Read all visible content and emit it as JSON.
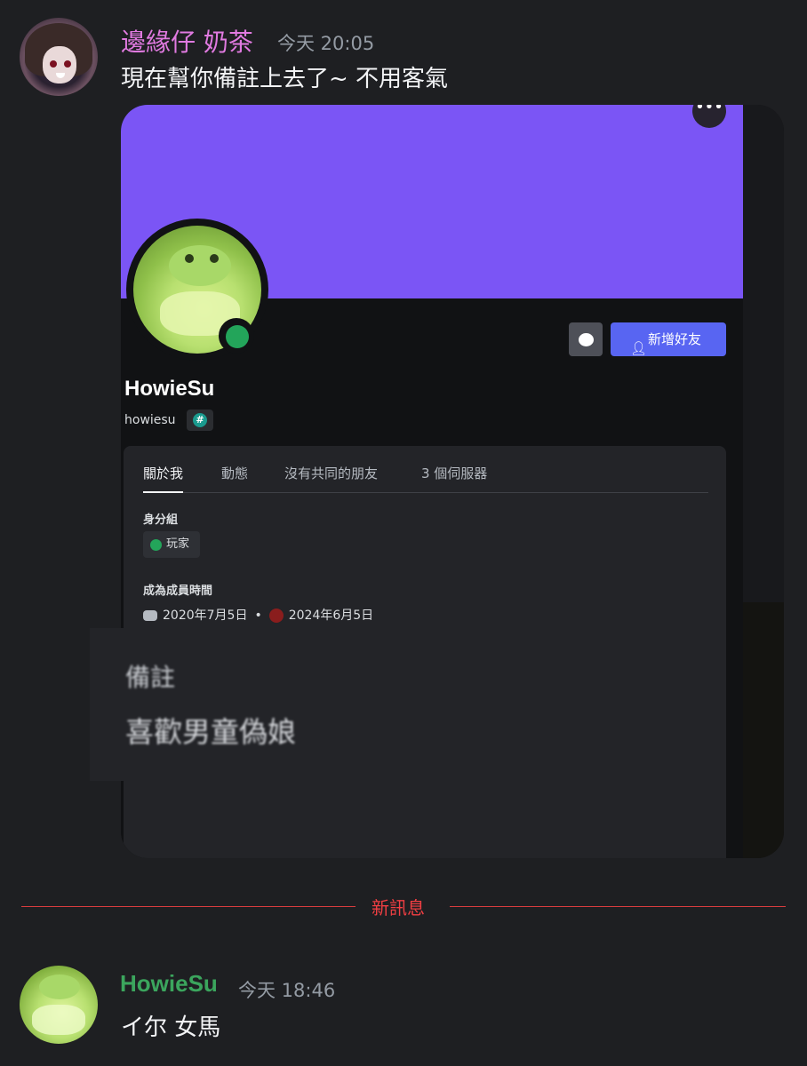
{
  "message1": {
    "username": "邊緣仔 奶茶",
    "timestamp": "今天 20:05",
    "text": "現在幫你備註上去了~ 不用客氣",
    "username_color": "#e07ae0"
  },
  "embed": {
    "banner_color": "#7b55f5",
    "dots_label": "•••",
    "add_friend_label": "新增好友",
    "profile": {
      "display_name": "HowieSu",
      "handle": "howiesu",
      "tag_glyph": "#"
    },
    "tabs": [
      "關於我",
      "動態",
      "沒有共同的朋友",
      "3 個伺服器"
    ],
    "roles_title": "身分組",
    "role_name": "玩家",
    "member_since_title": "成為成員時間",
    "member_since_discord": "2020年7月5日",
    "separator": "•",
    "member_since_server": "2024年6月5日",
    "note_title": "備註",
    "note_text": "喜歡男童偽娘"
  },
  "divider": {
    "label": "新訊息",
    "color": "#f23f43"
  },
  "message2": {
    "username": "HowieSu",
    "timestamp": "今天 18:46",
    "text": "イ尔 女馬",
    "username_color": "#3ba55d"
  }
}
